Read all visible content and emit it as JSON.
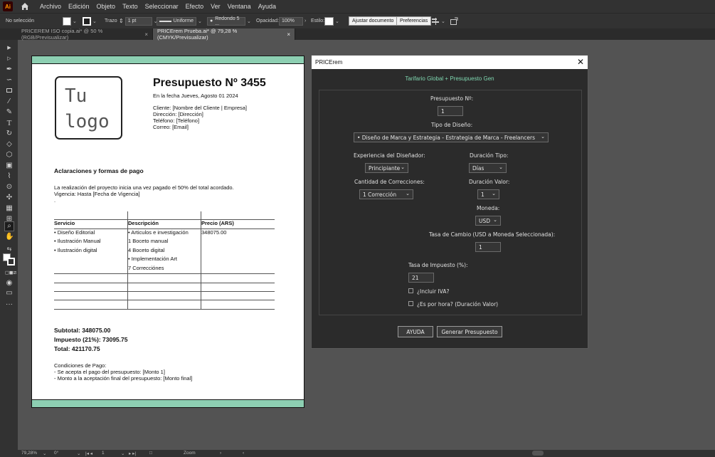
{
  "app": {
    "logo": "Ai"
  },
  "menu": [
    "Archivo",
    "Edición",
    "Objeto",
    "Texto",
    "Seleccionar",
    "Efecto",
    "Ver",
    "Ventana",
    "Ayuda"
  ],
  "control": {
    "selection": "No selección",
    "stroke_label": "Trazo",
    "stroke_weight": "1 pt",
    "profile": "Uniforme",
    "brush": "Redondo 5 ...",
    "opacity_label": "Opacidad:",
    "opacity": "100%",
    "style_label": "Estilo:",
    "fit_doc": "Ajustar documento",
    "prefs": "Preferencias"
  },
  "tabs": [
    {
      "label": "PRICEREM ISO copia.ai* @ 50 % (RGB/Previsualizar)",
      "active": false
    },
    {
      "label": "PRICErem Prueba.ai* @ 79,28 % (CMYK/Previsualizar)",
      "active": true
    }
  ],
  "doc": {
    "logo_line1": "Tu",
    "logo_line2": "logo",
    "title": "Presupuesto Nº 3455",
    "date": "En la fecha Jueves, Agosto 01 2024",
    "client": "Cliente: [Nombre del Cliente | Empresa]",
    "address": "Dirección: [Dirección]",
    "phone": "Teléfono: [Teléfono]",
    "email": "Correo: [Email]",
    "section_title": "Aclaraciones y formas de pago",
    "note1": "La realización del proyecto inicia una vez pagado el 50% del total acordado.",
    "note2": "Vigencia: Hasta [Fecha de Vigencia]",
    "note3": ".",
    "table": {
      "headers": [
        "Servicio",
        "Descripción",
        "Precio (ARS)"
      ],
      "services": [
        "• Diseño Editorial",
        "• Ilustración Manual",
        "• Ilustración digital"
      ],
      "descriptions": [
        "• Articulos e investigación",
        "1 Boceto manual",
        "4 Boceto digital",
        "• Implementación Art",
        "7 Correcciónes"
      ],
      "prices": [
        "348075.00"
      ]
    },
    "subtotal": "Subtotal: 348075.00",
    "tax": "Impuesto (21%): 73095.75",
    "total": "Total: 421170.75",
    "conditions_title": "Condiciones de Pago:",
    "condition1": "- Se acepta el pago del presupuesto: [Monto 1]",
    "condition2": "- Monto a la aceptación final del presupuesto: [Monto final]"
  },
  "dialog": {
    "title": "PRICErem",
    "subtitle": "Tarifario Global + Presupuesto Gen",
    "budget_label": "Presupuesto Nº:",
    "budget_value": "1",
    "design_type_label": "Tipo de Diseño:",
    "design_type_value": "• Diseño de Marca y Estrategia - Estrategia de Marca - Freelancers",
    "experience_label": "Experiencia del Diseñador:",
    "experience_value": "Principiante",
    "duration_type_label": "Duración Tipo:",
    "duration_type_value": "Días",
    "corrections_label": "Cantidad de Correcciones:",
    "corrections_value": "1 Corrección",
    "duration_value_label": "Duración Valor:",
    "duration_value": "1",
    "currency_label": "Moneda:",
    "currency_value": "USD",
    "exchange_label": "Tasa de Cambio (USD a Moneda Seleccionada):",
    "exchange_value": "1",
    "tax_label": "Tasa de Impuesto (%):",
    "tax_value": "21",
    "iva_label": "¿Incluir IVA?",
    "hourly_label": "¿Es por hora? (Duración Valor)",
    "help_button": "AYUDA",
    "generate_button": "Generar Presupuesto"
  },
  "status": {
    "zoom": "79,28%",
    "rotation": "0°",
    "artboard": "1",
    "tool": "Zoom"
  },
  "colors": {
    "accent": "#7fd7b0",
    "band": "#8dcfb2",
    "workspace": "#535353"
  }
}
